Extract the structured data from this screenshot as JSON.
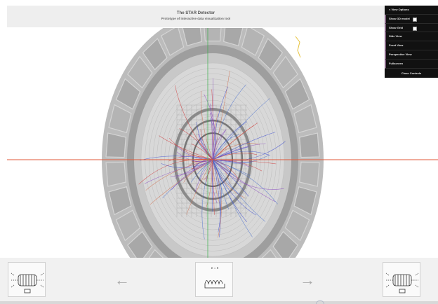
{
  "header": {
    "title": "The STAR Detector",
    "subtitle": "Prototype of interactive data visualization tool"
  },
  "controls": {
    "heading": "< View Options",
    "items": [
      {
        "label": "Show 3D model",
        "checkbox": true
      },
      {
        "label": "Show Grid",
        "checkbox": true
      },
      {
        "label": "Side View",
        "checkbox": false
      },
      {
        "label": "Front View",
        "checkbox": false
      },
      {
        "label": "Perspective View",
        "checkbox": false
      },
      {
        "label": "Fullscreen",
        "checkbox": false
      }
    ],
    "close_label": "Close Controls"
  },
  "navigation": {
    "prev_icon": "arrow-left-icon",
    "next_icon": "arrow-right-icon",
    "center_thumb_label": "Σ = 8"
  },
  "colors": {
    "axis_red": "#e05a3a",
    "axis_green": "#3ab04a",
    "track_blue": "#3a4ad0",
    "track_red": "#d03a3a",
    "panel_bg": "#111111"
  }
}
